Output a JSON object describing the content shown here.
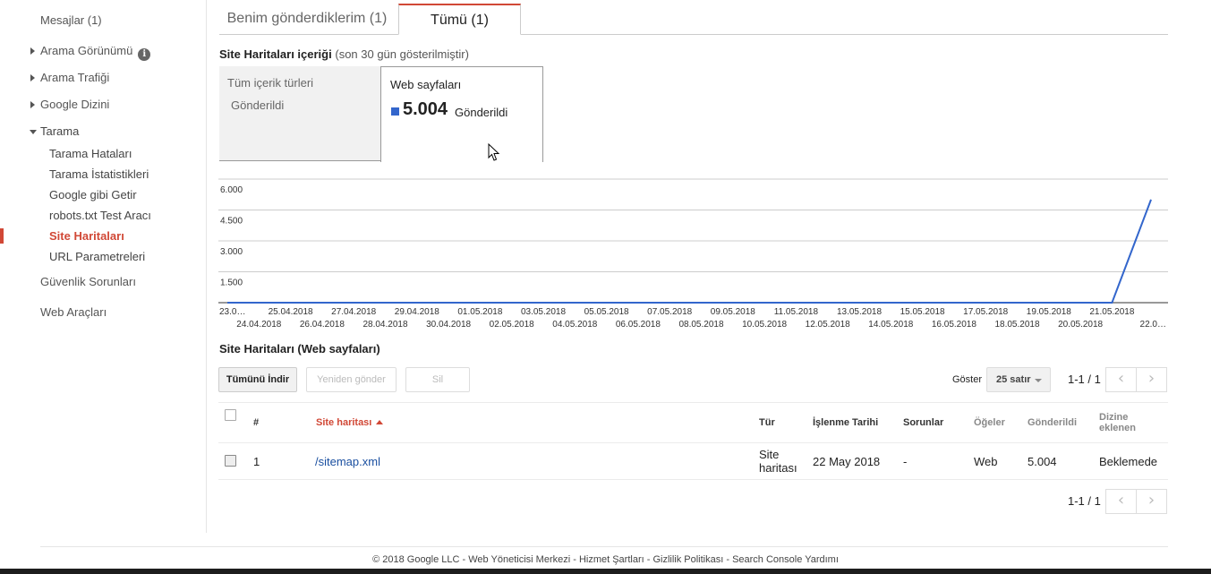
{
  "sidebar": {
    "messages": "Mesajlar (1)",
    "search_appearance": "Arama Görünümü",
    "search_traffic": "Arama Trafiği",
    "google_index": "Google Dizini",
    "crawl": "Tarama",
    "crawl_errors": "Tarama Hataları",
    "crawl_stats": "Tarama İstatistikleri",
    "fetch_as_google": "Google gibi Getir",
    "robots_tester": "robots.txt Test Aracı",
    "sitemaps": "Site Haritaları",
    "url_parameters": "URL Parametreleri",
    "security_issues": "Güvenlik Sorunları",
    "web_tools": "Web Araçları"
  },
  "tabs": {
    "mine": "Benim gönderdiklerim (1)",
    "all": "Tümü (1)"
  },
  "content": {
    "title": "Site Haritaları içeriği",
    "subtitle": "(son 30 gün gösterilmiştir)",
    "left_type": "Tüm içerik türleri",
    "left_status": "Gönderildi",
    "right_type": "Web sayfaları",
    "right_value": "5.004",
    "right_unit": "Gönderildi"
  },
  "colors": {
    "accent": "#d14836",
    "series": "#3366cc",
    "link": "#1a4fa0"
  },
  "chart_data": {
    "type": "line",
    "series": [
      {
        "values": [
          0,
          0,
          0,
          0,
          0,
          0,
          0,
          0,
          0,
          0,
          0,
          0,
          0,
          0,
          0,
          0,
          0,
          0,
          0,
          0,
          0,
          0,
          0,
          0,
          0,
          0,
          0,
          0,
          0,
          5004
        ]
      }
    ],
    "x_labels": [
      "23.0…",
      "24.04.2018",
      "25.04.2018",
      "26.04.2018",
      "27.04.2018",
      "28.04.2018",
      "29.04.2018",
      "30.04.2018",
      "01.05.2018",
      "02.05.2018",
      "03.05.2018",
      "04.05.2018",
      "05.05.2018",
      "06.05.2018",
      "07.05.2018",
      "08.05.2018",
      "09.05.2018",
      "10.05.2018",
      "11.05.2018",
      "12.05.2018",
      "13.05.2018",
      "14.05.2018",
      "15.05.2018",
      "16.05.2018",
      "17.05.2018",
      "18.05.2018",
      "19.05.2018",
      "20.05.2018",
      "21.05.2018",
      "22.0…"
    ],
    "y_ticks": [
      "6.000",
      "4.500",
      "3.000",
      "1.500"
    ],
    "ylim": [
      0,
      6000
    ],
    "grid": true
  },
  "table": {
    "title": "Site Haritaları (Web sayfaları)",
    "download": "Tümünü İndir",
    "resubmit": "Yeniden gönder",
    "delete": "Sil",
    "show": "Göster",
    "rows_option": "25 satır",
    "pager": "1-1 / 1",
    "headers": {
      "num": "#",
      "sitemap": "Site haritası",
      "type": "Tür",
      "processed": "İşlenme Tarihi",
      "issues": "Sorunlar",
      "items": "Öğeler",
      "submitted": "Gönderildi",
      "indexed_1": "Dizine",
      "indexed_2": "eklenen"
    },
    "rows": [
      {
        "num": "1",
        "sitemap": "/sitemap.xml",
        "type_1": "Site",
        "type_2": "haritası",
        "processed": "22 May 2018",
        "issues": "-",
        "items": "Web",
        "submitted": "5.004",
        "indexed": "Beklemede"
      }
    ]
  },
  "icons": {
    "info": "info-icon",
    "prev": "chevron-left-icon",
    "next": "chevron-right-icon"
  },
  "footer": "© 2018 Google LLC - Web Yöneticisi Merkezi - Hizmet Şartları - Gizlilik Politikası - Search Console Yardımı"
}
